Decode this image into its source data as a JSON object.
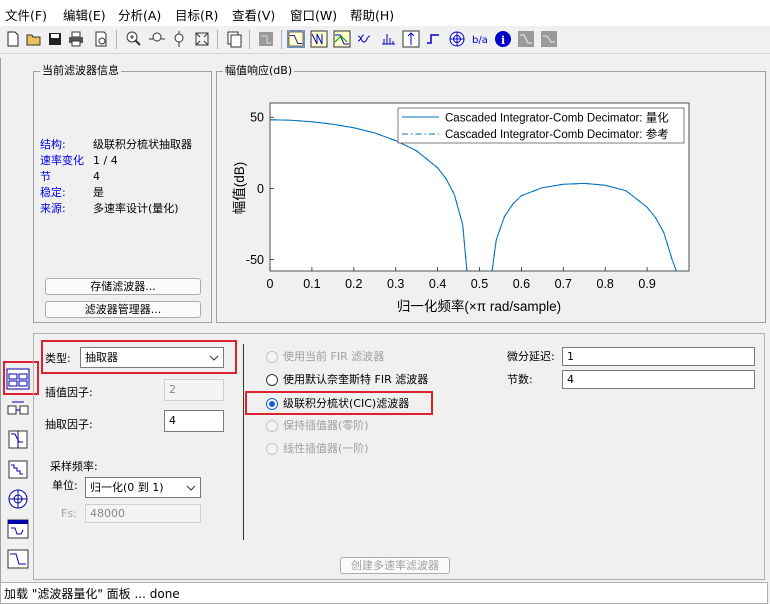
{
  "menu": [
    "文件(F)",
    "编辑(E)",
    "分析(A)",
    "目标(R)",
    "查看(V)",
    "窗口(W)",
    "帮助(H)"
  ],
  "toolbar_icons": [
    "new-icon",
    "open-icon",
    "save-icon",
    "print-icon",
    "print-preview-icon",
    "zoom-in-icon",
    "zoom-x-icon",
    "zoom-y-icon",
    "full-view-icon",
    "new-figure-icon",
    "filter-spec-icon",
    "magnitude-response-icon",
    "phase-response-icon",
    "magnitude-phase-icon",
    "group-delay-icon",
    "impulse-response-icon",
    "step-response-icon",
    "pole-zero-icon",
    "filter-coefficients-icon",
    "info-icon",
    "magnitude-estimate-icon",
    "noise-power-icon"
  ],
  "filter_info": {
    "title": "当前滤波器信息",
    "rows": [
      {
        "key": "结构:",
        "value": "级联积分梳状抽取器"
      },
      {
        "key": "速率变化",
        "value": "1 / 4"
      },
      {
        "key": "节",
        "value": "4"
      },
      {
        "key": "稳定:",
        "value": "是"
      },
      {
        "key": "来源:",
        "value": "多速率设计(量化)"
      }
    ],
    "store_button": "存储滤波器...",
    "manager_button": "滤波器管理器..."
  },
  "plot": {
    "title": "幅值响应(dB)",
    "ylabel": "幅值(dB)",
    "xlabel": "归一化频率(×π rad/sample)",
    "legend": [
      "Cascaded Integrator-Comb Decimator: 量化",
      "Cascaded Integrator-Comb Decimator: 参考"
    ],
    "xticks": [
      "0",
      "0.1",
      "0.2",
      "0.3",
      "0.4",
      "0.5",
      "0.6",
      "0.7",
      "0.8",
      "0.9"
    ],
    "yticks": [
      "50",
      "0",
      "-50"
    ]
  },
  "chart_data": {
    "type": "line",
    "title": "幅值响应(dB)",
    "xlabel": "归一化频率(×π rad/sample)",
    "ylabel": "幅值(dB)",
    "xlim": [
      0,
      1
    ],
    "ylim": [
      -58,
      60
    ],
    "grid": false,
    "legend_position": "top-right",
    "series": [
      {
        "name": "Cascaded Integrator-Comb Decimator: 量化",
        "style": "solid",
        "color": "#0072bd",
        "x": [
          0,
          0.05,
          0.1,
          0.15,
          0.2,
          0.25,
          0.3,
          0.35,
          0.4,
          0.42,
          0.44,
          0.46,
          0.47,
          0.5,
          0.53,
          0.54,
          0.56,
          0.58,
          0.6,
          0.65,
          0.7,
          0.75,
          0.8,
          0.85,
          0.9,
          0.92,
          0.94,
          0.96,
          0.97
        ],
        "y": [
          48.2,
          47.9,
          46.8,
          45.1,
          42.6,
          38.9,
          33.6,
          26.4,
          14.5,
          6.8,
          -4.4,
          -25.4,
          -58,
          -900,
          -58,
          -36,
          -19.5,
          -10.8,
          -5.1,
          0.5,
          2.9,
          3.5,
          2.2,
          -1.7,
          -13.2,
          -20.5,
          -31.2,
          -50.1,
          -58
        ]
      },
      {
        "name": "Cascaded Integrator-Comb Decimator: 参考",
        "style": "dashdot",
        "color": "#0072bd",
        "x": [
          0,
          0.05,
          0.1,
          0.15,
          0.2,
          0.25,
          0.3,
          0.35,
          0.4,
          0.42,
          0.44,
          0.46,
          0.47,
          0.5,
          0.53,
          0.54,
          0.56,
          0.58,
          0.6,
          0.65,
          0.7,
          0.75,
          0.8,
          0.85,
          0.9,
          0.92,
          0.94,
          0.96,
          0.97
        ],
        "y": [
          48.2,
          47.9,
          46.8,
          45.1,
          42.6,
          38.9,
          33.6,
          26.4,
          14.5,
          6.8,
          -4.4,
          -25.4,
          -58,
          -900,
          -58,
          -36,
          -19.5,
          -10.8,
          -5.1,
          0.5,
          2.9,
          3.5,
          2.2,
          -1.7,
          -13.2,
          -20.5,
          -31.2,
          -50.1,
          -58
        ]
      }
    ]
  },
  "design": {
    "type_label": "类型:",
    "type_value": "抽取器",
    "interp_factor_label": "插值因子:",
    "interp_factor_value": "2",
    "decim_factor_label": "抽取因子:",
    "decim_factor_value": "4",
    "sampling_title": "采样频率:",
    "units_label": "单位:",
    "units_value": "归一化(0 到 1)",
    "fs_label": "Fs:",
    "fs_value": "48000",
    "radios": [
      {
        "label": "使用当前 FIR 滤波器",
        "state": "disabled"
      },
      {
        "label": "使用默认奈奎斯特 FIR 滤波器",
        "state": "enabled"
      },
      {
        "label": "级联积分梳状(CIC)滤波器",
        "state": "selected"
      },
      {
        "label": "保持插值器(零阶)",
        "state": "disabled"
      },
      {
        "label": "线性插值器(一阶)",
        "state": "disabled"
      }
    ],
    "diff_delay_label": "微分延迟:",
    "diff_delay_value": "1",
    "sections_label": "节数:",
    "sections_value": "4",
    "create_button": "创建多速率滤波器"
  },
  "sidebar_icons": [
    "multirate-design-icon",
    "realize-model-icon",
    "transform-filter-icon",
    "quantize-filter-icon",
    "pole-zero-editor-icon",
    "import-filter-icon",
    "design-filter-icon"
  ],
  "status": "加载 \"滤波器量化\" 面板 ... done",
  "accent_colors": {
    "highlight_red": "#d9232e",
    "plot_line": "#0072bd",
    "info_keys": "#0000ee"
  }
}
